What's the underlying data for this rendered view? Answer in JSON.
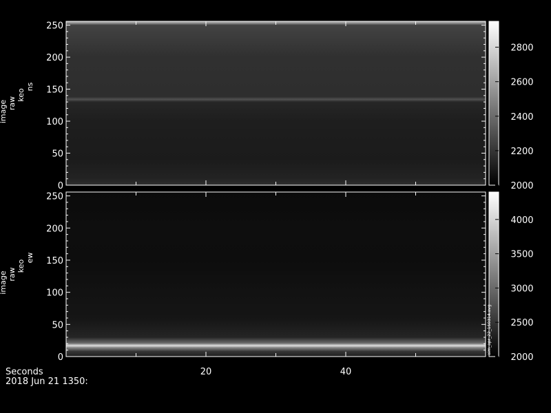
{
  "colors": {
    "background": "#000000",
    "foreground": "#ffffff"
  },
  "chart_data": [
    {
      "type": "heatmap",
      "ylabel": [
        "image",
        "raw",
        "keo",
        "ns"
      ],
      "xlim": [
        0,
        60
      ],
      "ylim": [
        0,
        256
      ],
      "y_ticks": [
        0,
        50,
        100,
        150,
        200,
        250
      ],
      "x_ticks": [
        20,
        40
      ],
      "colorbar": {
        "min": 2000,
        "max": 2950,
        "ticks": [
          2000,
          2200,
          2400,
          2600,
          2800
        ]
      },
      "colormap": "grayscale",
      "profile": [
        {
          "y": 0,
          "value": 2180
        },
        {
          "y": 10,
          "value": 2130
        },
        {
          "y": 40,
          "value": 2100
        },
        {
          "y": 100,
          "value": 2110
        },
        {
          "y": 130,
          "value": 2140
        },
        {
          "y": 134,
          "value": 2300
        },
        {
          "y": 138,
          "value": 2170
        },
        {
          "y": 200,
          "value": 2180
        },
        {
          "y": 250,
          "value": 2250
        },
        {
          "y": 254,
          "value": 2600
        }
      ]
    },
    {
      "type": "heatmap",
      "ylabel": [
        "image",
        "raw",
        "keo",
        "ew"
      ],
      "xlim": [
        0,
        60
      ],
      "ylim": [
        0,
        256
      ],
      "y_ticks": [
        0,
        50,
        100,
        150,
        200,
        250
      ],
      "x_ticks": [
        20,
        40
      ],
      "colorbar": {
        "min": 2000,
        "max": 4400,
        "ticks": [
          2000,
          2500,
          3000,
          3500,
          4000
        ]
      },
      "colormap": "grayscale",
      "profile": [
        {
          "y": 0,
          "value": 2300
        },
        {
          "y": 8,
          "value": 2500
        },
        {
          "y": 14,
          "value": 3300
        },
        {
          "y": 17,
          "value": 4100
        },
        {
          "y": 21,
          "value": 3000
        },
        {
          "y": 30,
          "value": 2350
        },
        {
          "y": 60,
          "value": 2200
        },
        {
          "y": 100,
          "value": 2170
        },
        {
          "y": 150,
          "value": 2120
        },
        {
          "y": 200,
          "value": 2130
        },
        {
          "y": 255,
          "value": 2100
        }
      ],
      "side_note": "aim_apr_22_150314.avg"
    }
  ],
  "xaxis": {
    "label": "Seconds",
    "date": "2018 Jun 21 1350:"
  }
}
